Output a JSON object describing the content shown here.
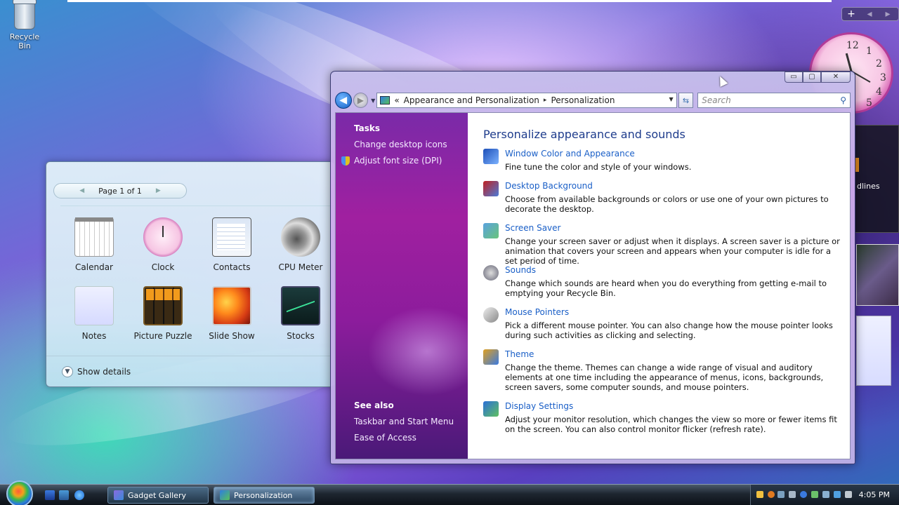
{
  "desktop": {
    "recycle_bin_label": "Recycle Bin"
  },
  "sidebar": {
    "controls": [
      "+",
      "◂",
      "▸"
    ],
    "partial_text": "dlines",
    "clock_numbers": [
      "12",
      "1",
      "2",
      "3",
      "4",
      "5"
    ]
  },
  "gadget_gallery": {
    "pager_label": "Page 1 of 1",
    "items": [
      {
        "label": "Calendar",
        "icon": "calendar-icon"
      },
      {
        "label": "Clock",
        "icon": "clock-icon"
      },
      {
        "label": "Contacts",
        "icon": "contacts-icon"
      },
      {
        "label": "CPU Meter",
        "icon": "cpu-meter-icon"
      },
      {
        "label": "Notes",
        "icon": "notes-icon"
      },
      {
        "label": "Picture Puzzle",
        "icon": "picture-puzzle-icon"
      },
      {
        "label": "Slide Show",
        "icon": "slide-show-icon"
      },
      {
        "label": "Stocks",
        "icon": "stocks-icon"
      }
    ],
    "show_details": "Show details"
  },
  "window": {
    "caption_buttons": {
      "minimize": "▭",
      "maximize": "▢",
      "close": "✕"
    },
    "address": {
      "chevron": "«",
      "crumb1": "Appearance and Personalization",
      "crumb_sep": "▸",
      "crumb2": "Personalization"
    },
    "search_placeholder": "Search",
    "left_pane": {
      "tasks_heading": "Tasks",
      "tasks": [
        "Change desktop icons",
        "Adjust font size (DPI)"
      ],
      "see_also_heading": "See also",
      "see_also": [
        "Taskbar and Start Menu",
        "Ease of Access"
      ]
    },
    "content": {
      "title": "Personalize appearance and sounds",
      "items": [
        {
          "link": "Window Color and Appearance",
          "desc": "Fine tune the color and style of your windows.",
          "icon": "window-color-icon"
        },
        {
          "link": "Desktop Background",
          "desc": "Choose from available backgrounds or colors or use one of your own pictures to decorate the desktop.",
          "icon": "desktop-background-icon"
        },
        {
          "link": "Screen Saver",
          "desc": "Change your screen saver or adjust when it displays. A screen saver is a picture or animation that covers your screen and appears when your computer is idle for a set period of time.",
          "icon": "screen-saver-icon"
        },
        {
          "link": "Sounds",
          "desc": "Change which sounds are heard when you do everything from getting e-mail to emptying your Recycle Bin.",
          "icon": "sounds-icon"
        },
        {
          "link": "Mouse Pointers",
          "desc": "Pick a different mouse pointer. You can also change how the mouse pointer looks during such activities as clicking and selecting.",
          "icon": "mouse-pointers-icon"
        },
        {
          "link": "Theme",
          "desc": "Change the theme. Themes can change a wide range of visual and auditory elements at one time including the appearance of menus, icons, backgrounds, screen savers, some computer sounds, and mouse pointers.",
          "icon": "theme-icon"
        },
        {
          "link": "Display Settings",
          "desc": "Adjust your monitor resolution, which changes the view so more or fewer items fit on the screen. You can also control monitor flicker (refresh rate).",
          "icon": "display-settings-icon"
        }
      ]
    }
  },
  "taskbar": {
    "buttons": [
      {
        "label": "Gadget Gallery"
      },
      {
        "label": "Personalization"
      }
    ],
    "clock": "4:05 PM"
  }
}
